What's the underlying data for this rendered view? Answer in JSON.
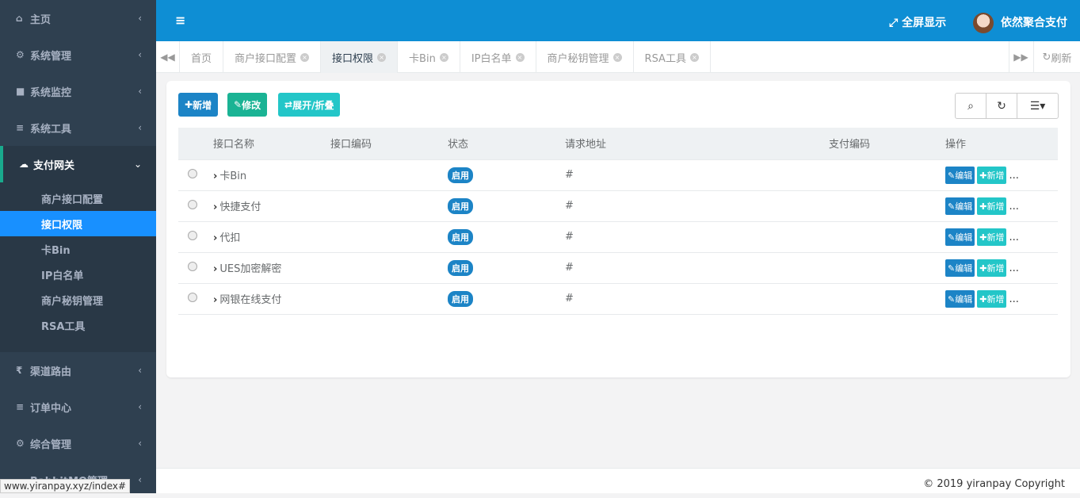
{
  "sidebar": {
    "items": [
      {
        "icon": "home-icon",
        "label": "主页"
      },
      {
        "icon": "gear-icon",
        "label": "系统管理"
      },
      {
        "icon": "video-icon",
        "label": "系统监控"
      },
      {
        "icon": "bars-icon",
        "label": "系统工具"
      }
    ],
    "active": {
      "icon": "cloud-icon",
      "label": "支付网关"
    },
    "subitems": [
      "商户接口配置",
      "接口权限",
      "卡Bin",
      "IP白名单",
      "商户秘钥管理",
      "RSA工具"
    ],
    "lower_items": [
      {
        "icon": "rupee-icon",
        "label": "渠道路由"
      },
      {
        "icon": "bars-icon",
        "label": "订单中心"
      },
      {
        "icon": "cogs-icon",
        "label": "综合管理"
      },
      {
        "icon": "cloud-icon",
        "label": "RabbitMQ管理"
      }
    ]
  },
  "status_url": "www.yiranpay.xyz/index#",
  "topbar": {
    "fullscreen_label": "全屏显示",
    "user_name": "依然聚合支付"
  },
  "tabs": [
    {
      "label": "首页",
      "closable": false
    },
    {
      "label": "商户接口配置",
      "closable": true
    },
    {
      "label": "接口权限",
      "closable": true,
      "active": true
    },
    {
      "label": "卡Bin",
      "closable": true
    },
    {
      "label": "IP白名单",
      "closable": true
    },
    {
      "label": "商户秘钥管理",
      "closable": true
    },
    {
      "label": "RSA工具",
      "closable": true
    }
  ],
  "refresh_label": "刷新",
  "toolbar": {
    "add_label": "新增",
    "edit_label": "修改",
    "toggle_label": "展开/折叠"
  },
  "table": {
    "headers": [
      "接口名称",
      "接口编码",
      "状态",
      "请求地址",
      "支付编码",
      "操作"
    ],
    "rows": [
      {
        "name": "卡Bin",
        "code": "",
        "status": "启用",
        "url": "#",
        "pay_code": ""
      },
      {
        "name": "快捷支付",
        "code": "",
        "status": "启用",
        "url": "#",
        "pay_code": ""
      },
      {
        "name": "代扣",
        "code": "",
        "status": "启用",
        "url": "#",
        "pay_code": ""
      },
      {
        "name": "UES加密解密",
        "code": "",
        "status": "启用",
        "url": "#",
        "pay_code": ""
      },
      {
        "name": "网银在线支付",
        "code": "",
        "status": "启用",
        "url": "#",
        "pay_code": ""
      }
    ],
    "row_edit_label": "编辑",
    "row_add_label": "新增",
    "row_more": "..."
  },
  "footer": {
    "copyright": "© 2019 yiranpay Copyright"
  }
}
